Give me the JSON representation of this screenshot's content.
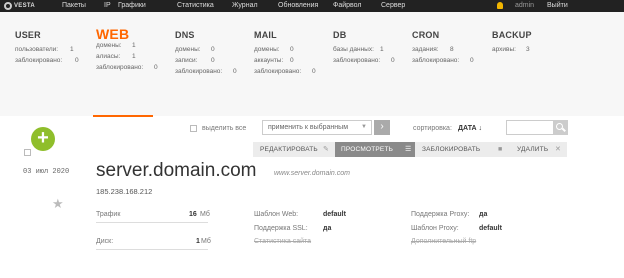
{
  "topnav": {
    "logo": "VESTA",
    "items": [
      "Пакеты",
      "IP",
      "Графики",
      "Статистика",
      "Журнал",
      "Обновления",
      "Файрвол",
      "Сервер"
    ],
    "user": "admin",
    "logout": "Выйти"
  },
  "stats": [
    {
      "title": "USER",
      "rows": [
        {
          "label": "пользователи:",
          "value": "1"
        },
        {
          "label": "заблокировано:",
          "value": "0"
        }
      ]
    },
    {
      "title": "WEB",
      "rows": [
        {
          "label": "домены:",
          "value": "1"
        },
        {
          "label": "алиасы:",
          "value": "1"
        },
        {
          "label": "заблокировано:",
          "value": "0"
        }
      ]
    },
    {
      "title": "DNS",
      "rows": [
        {
          "label": "домены:",
          "value": "0"
        },
        {
          "label": "записи:",
          "value": "0"
        },
        {
          "label": "заблокировано:",
          "value": "0"
        }
      ]
    },
    {
      "title": "MAIL",
      "rows": [
        {
          "label": "домены:",
          "value": "0"
        },
        {
          "label": "аккаунты:",
          "value": "0"
        },
        {
          "label": "заблокировано:",
          "value": "0"
        }
      ]
    },
    {
      "title": "DB",
      "rows": [
        {
          "label": "базы данных:",
          "value": "1"
        },
        {
          "label": "заблокировано:",
          "value": "0"
        }
      ]
    },
    {
      "title": "CRON",
      "rows": [
        {
          "label": "задания:",
          "value": "8"
        },
        {
          "label": "заблокировано:",
          "value": "0"
        }
      ]
    },
    {
      "title": "BACKUP",
      "rows": [
        {
          "label": "архивы:",
          "value": "3"
        }
      ]
    }
  ],
  "toolbar": {
    "select_all": "выделить все",
    "bulk_action": "применить к выбранным",
    "sort_label": "сортировка:",
    "sort_value": "ДАТА ↓",
    "search_placeholder": ""
  },
  "actions": {
    "edit": "РЕДАКТИРОВАТЬ",
    "logs": "ПРОСМОТРЕТЬ ЛОГИ",
    "suspend": "ЗАБЛОКИРОВАТЬ",
    "delete": "УДАЛИТЬ"
  },
  "record": {
    "date": "03 июл 2020",
    "domain": "server.domain.com",
    "alias": "www.server.domain.com",
    "ip": "185.238.168.212",
    "traffic_label": "Трафик",
    "traffic_value": "16",
    "traffic_unit": "Мб",
    "disk_label": "Диск:",
    "disk_value": "1",
    "disk_unit": "Мб",
    "web_template_label": "Шаблон Web:",
    "web_template_value": "default",
    "ssl_label": "Поддержка SSL:",
    "ssl_value": "да",
    "stats_label": "Статистика сайта",
    "proxy_label": "Поддержка Proxy:",
    "proxy_value": "да",
    "proxy_template_label": "Шаблон Proxy:",
    "proxy_template_value": "default",
    "extensions_label": "Дополнительный ftp"
  }
}
